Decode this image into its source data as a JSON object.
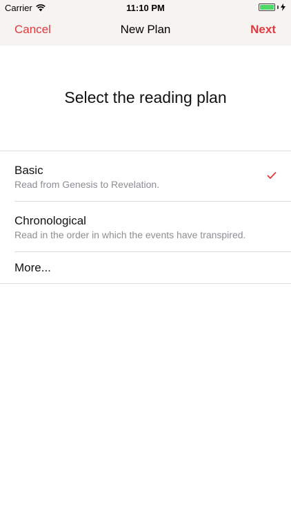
{
  "status_bar": {
    "carrier": "Carrier",
    "time": "11:10 PM",
    "battery_color": "#4cd964"
  },
  "nav": {
    "cancel_label": "Cancel",
    "title": "New Plan",
    "next_label": "Next",
    "accent_color": "#e03a3e"
  },
  "heading": "Select the reading plan",
  "plans": [
    {
      "title": "Basic",
      "subtitle": "Read from Genesis to Revelation.",
      "selected": true
    },
    {
      "title": "Chronological",
      "subtitle": "Read in the order in which the events have transpired.",
      "selected": false
    }
  ],
  "more_label": "More..."
}
